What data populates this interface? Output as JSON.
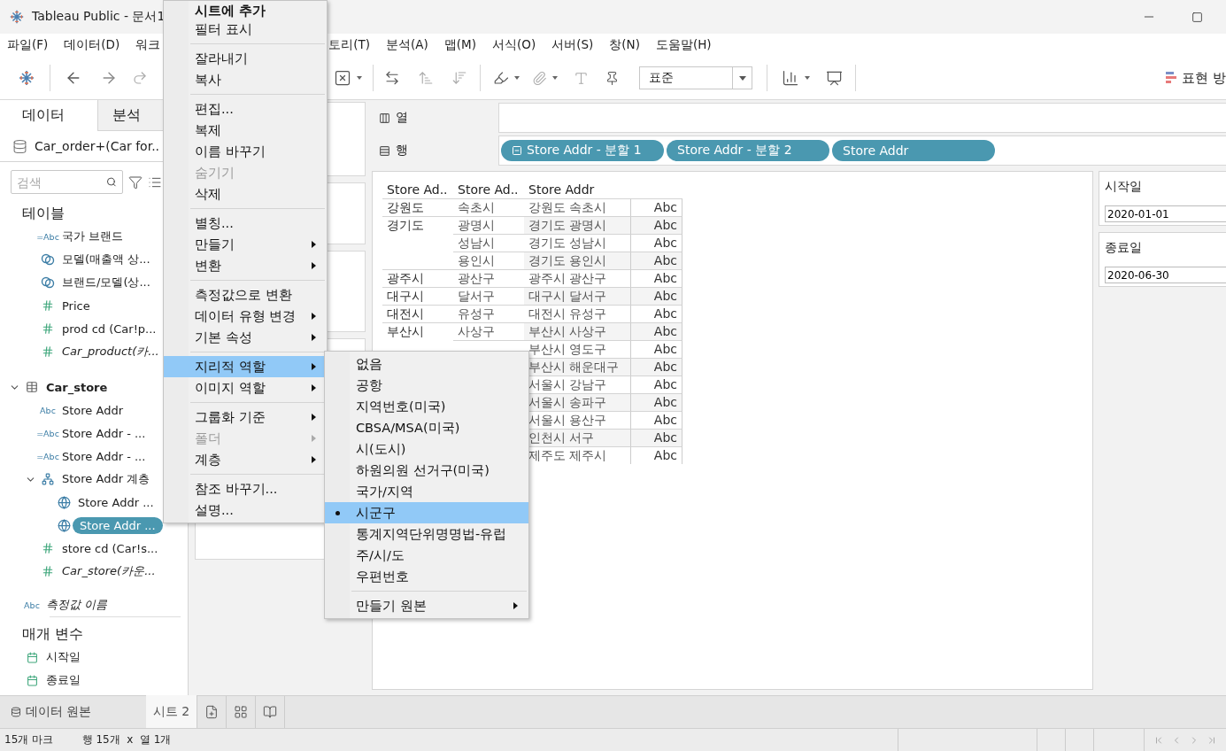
{
  "window": {
    "title": "Tableau Public - 문서1"
  },
  "menu_bar": [
    "파일(F)",
    "데이터(D)",
    "워크",
    "토리(T)",
    "분석(A)",
    "맵(M)",
    "서식(O)",
    "서버(S)",
    "창(N)",
    "도움말(H)"
  ],
  "toolbar": {
    "mark_size": "표준",
    "show_me": "표현 방"
  },
  "data_pane": {
    "tabs": [
      {
        "label": "데이터",
        "selected": true
      },
      {
        "label": "분석",
        "selected": false
      }
    ],
    "data_source": "Car_order+(Car for..",
    "search": {
      "placeholder": "검색"
    },
    "heading": "테이블",
    "fields": [
      {
        "label": "국가 브랜드",
        "kind": "dimension",
        "icon": "=Abc",
        "selected": false
      },
      {
        "label": "모델(매출액 상...",
        "kind": "set",
        "selected": false
      },
      {
        "label": "브랜드/모델(상...",
        "kind": "set",
        "selected": false
      },
      {
        "label": "Price",
        "kind": "measure",
        "selected": false
      },
      {
        "label": "prod cd (Car!p...",
        "kind": "measure",
        "selected": false
      },
      {
        "label": "Car_product(카...",
        "kind": "count",
        "selected": false
      }
    ],
    "tables": [
      {
        "label": "Car_store",
        "expanded": true,
        "children": [
          {
            "label": "Store Addr",
            "kind": "dimension",
            "icon": "Abc",
            "selected": false
          },
          {
            "label": "Store Addr - ...",
            "kind": "dimension",
            "icon": "=Abc",
            "selected": false
          },
          {
            "label": "Store Addr - ...",
            "kind": "dimension",
            "icon": "=Abc",
            "selected": false
          },
          {
            "label": "Store Addr 계층",
            "kind": "hierarchy",
            "expanded": true,
            "selected": false,
            "children": [
              {
                "label": "Store Addr ...",
                "kind": "geo",
                "selected": false
              },
              {
                "label": "Store Addr ...",
                "kind": "geo",
                "selected": true
              }
            ]
          },
          {
            "label": "store cd (Car!s...",
            "kind": "measure",
            "selected": false
          },
          {
            "label": "Car_store(카운...",
            "kind": "count",
            "selected": false
          }
        ]
      }
    ],
    "measure_names": {
      "label": "측정값 이름",
      "icon": "Abc"
    },
    "parameters": {
      "heading": "매개 변수",
      "items": [
        "시작일",
        "종료일"
      ]
    }
  },
  "shelves": {
    "columns": {
      "label": "열"
    },
    "rows": {
      "label": "행",
      "pills": [
        {
          "label": "Store Addr - 분할 1",
          "collapsible": true
        },
        {
          "label": "Store Addr - 분할 2",
          "collapsible": false
        },
        {
          "label": "Store Addr",
          "collapsible": false
        }
      ]
    }
  },
  "view": {
    "columns": [
      "Store Ad..",
      "Store Ad..",
      "Store Addr"
    ],
    "rows": [
      {
        "column_1": "강원도",
        "column_2": "속초시",
        "column_3": "강원도 속초시",
        "column_4": "Abc"
      },
      {
        "column_1": "경기도",
        "column_2": "광명시",
        "column_3": "경기도 광명시",
        "column_4": "Abc"
      },
      {
        "column_2": "성남시",
        "column_3": "경기도 성남시",
        "column_4": "Abc"
      },
      {
        "column_2": "용인시",
        "column_3": "경기도 용인시",
        "column_4": "Abc"
      },
      {
        "column_1": "광주시",
        "column_2": "광산구",
        "column_3": "광주시 광산구",
        "column_4": "Abc"
      },
      {
        "column_1": "대구시",
        "column_2": "달서구",
        "column_3": "대구시 달서구",
        "column_4": "Abc"
      },
      {
        "column_1": "대전시",
        "column_2": "유성구",
        "column_3": "대전시 유성구",
        "column_4": "Abc"
      },
      {
        "column_1": "부산시",
        "column_2": "사상구",
        "column_3": "부산시 사상구",
        "column_4": "Abc"
      },
      {
        "column_3": "부산시 영도구",
        "column_4": "Abc"
      },
      {
        "column_3": "부산시 해운대구",
        "column_4": "Abc"
      },
      {
        "column_3": "서울시 강남구",
        "column_4": "Abc"
      },
      {
        "column_3": "서울시 송파구",
        "column_4": "Abc"
      },
      {
        "column_3": "서울시 용산구",
        "column_4": "Abc"
      },
      {
        "column_3": "인천시 서구",
        "column_4": "Abc"
      },
      {
        "column_3": "제주도 제주시",
        "column_4": "Abc"
      }
    ]
  },
  "parameter_controls": [
    {
      "title": "시작일",
      "value": "2020-01-01"
    },
    {
      "title": "종료일",
      "value": "2020-06-30"
    }
  ],
  "sheet_tabs": {
    "data_source": "데이터 원본",
    "sheets": [
      {
        "label": "시트 2",
        "selected": true
      }
    ]
  },
  "status_bar": {
    "marks": "15개 마크",
    "size": "행 15개  x  열 1개"
  },
  "context_menu": {
    "sections": [
      [
        {
          "label": "시트에 추가",
          "bold": true,
          "submenu": false,
          "disabled": false,
          "highlighted": false
        },
        {
          "label": "필터 표시",
          "bold": false,
          "submenu": false,
          "disabled": false,
          "highlighted": false
        }
      ],
      [
        {
          "label": "잘라내기",
          "bold": false,
          "submenu": false,
          "disabled": false,
          "highlighted": false
        },
        {
          "label": "복사",
          "bold": false,
          "submenu": false,
          "disabled": false,
          "highlighted": false
        }
      ],
      [
        {
          "label": "편집...",
          "bold": false,
          "submenu": false,
          "disabled": false,
          "highlighted": false
        },
        {
          "label": "복제",
          "bold": false,
          "submenu": false,
          "disabled": false,
          "highlighted": false
        },
        {
          "label": "이름 바꾸기",
          "bold": false,
          "submenu": false,
          "disabled": false,
          "highlighted": false
        },
        {
          "label": "숨기기",
          "bold": false,
          "submenu": false,
          "disabled": true,
          "highlighted": false
        },
        {
          "label": "삭제",
          "bold": false,
          "submenu": false,
          "disabled": false,
          "highlighted": false
        }
      ],
      [
        {
          "label": "별칭...",
          "bold": false,
          "submenu": false,
          "disabled": false,
          "highlighted": false
        },
        {
          "label": "만들기",
          "bold": false,
          "submenu": true,
          "disabled": false,
          "highlighted": false
        },
        {
          "label": "변환",
          "bold": false,
          "submenu": true,
          "disabled": false,
          "highlighted": false
        }
      ],
      [
        {
          "label": "측정값으로 변환",
          "bold": false,
          "submenu": false,
          "disabled": false,
          "highlighted": false
        },
        {
          "label": "데이터 유형 변경",
          "bold": false,
          "submenu": true,
          "disabled": false,
          "highlighted": false
        },
        {
          "label": "기본 속성",
          "bold": false,
          "submenu": true,
          "disabled": false,
          "highlighted": false
        }
      ],
      [
        {
          "label": "지리적 역할",
          "bold": false,
          "submenu": true,
          "disabled": false,
          "highlighted": true
        },
        {
          "label": "이미지 역할",
          "bold": false,
          "submenu": true,
          "disabled": false,
          "highlighted": false
        }
      ],
      [
        {
          "label": "그룹화 기준",
          "bold": false,
          "submenu": true,
          "disabled": false,
          "highlighted": false
        },
        {
          "label": "폴더",
          "bold": false,
          "submenu": true,
          "disabled": true,
          "highlighted": false
        },
        {
          "label": "계층",
          "bold": false,
          "submenu": true,
          "disabled": false,
          "highlighted": false
        }
      ],
      [
        {
          "label": "참조 바꾸기...",
          "bold": false,
          "submenu": false,
          "disabled": false,
          "highlighted": false
        },
        {
          "label": "설명...",
          "bold": false,
          "submenu": false,
          "disabled": false,
          "highlighted": false
        }
      ]
    ]
  },
  "geo_submenu": {
    "items": [
      {
        "label": "없음",
        "selected": false
      },
      {
        "label": "공항",
        "selected": false
      },
      {
        "label": "지역번호(미국)",
        "selected": false
      },
      {
        "label": "CBSA/MSA(미국)",
        "selected": false
      },
      {
        "label": "시(도시)",
        "selected": false
      },
      {
        "label": "하원의원 선거구(미국)",
        "selected": false
      },
      {
        "label": "국가/지역",
        "selected": false
      },
      {
        "label": "시군구",
        "selected": true
      },
      {
        "label": "통계지역단위명명법-유럽",
        "selected": false
      },
      {
        "label": "주/시/도",
        "selected": false
      },
      {
        "label": "우편번호",
        "selected": false
      }
    ],
    "footer": {
      "label": "만들기 원본",
      "submenu": true
    }
  }
}
